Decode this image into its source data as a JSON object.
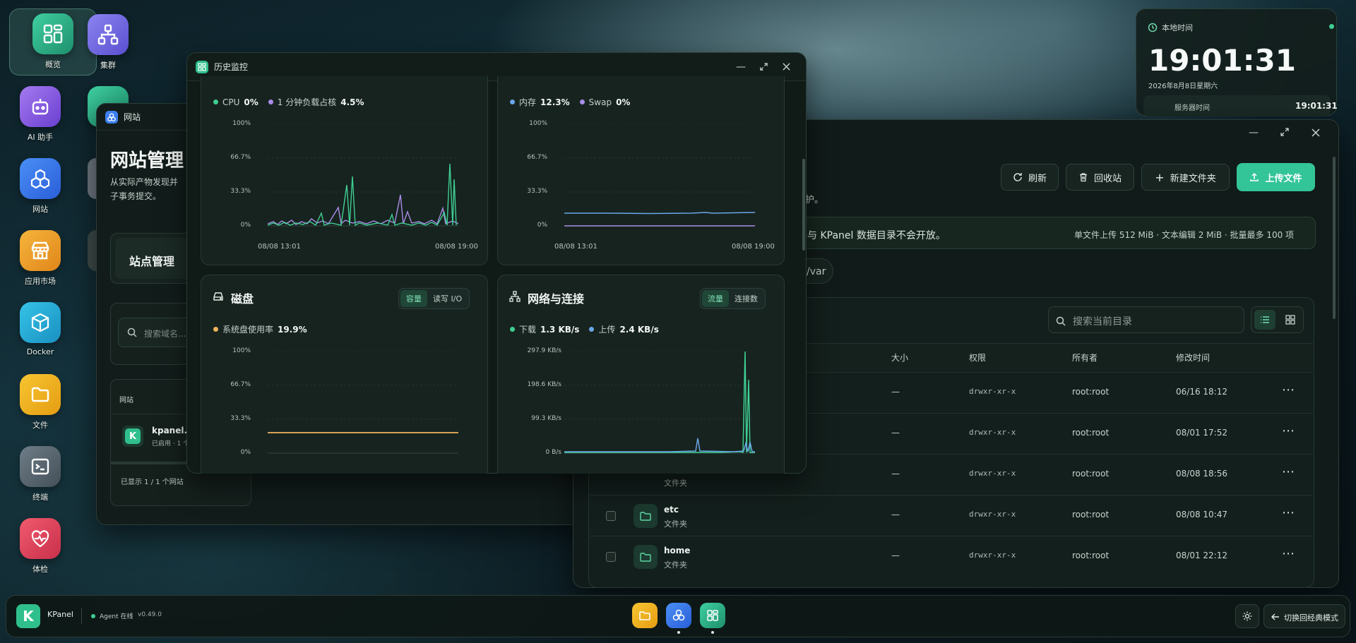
{
  "desktop": {
    "icons": [
      {
        "label": "概览"
      },
      {
        "label": "集群"
      },
      {
        "label": "AI 助手"
      },
      {
        "label": "网站"
      },
      {
        "label": "应用市场"
      },
      {
        "label": "Docker"
      },
      {
        "label": "文件"
      },
      {
        "label": "终端"
      },
      {
        "label": "体检"
      }
    ]
  },
  "clock": {
    "title": "本地时间",
    "time": "19:01:31",
    "date": "2026年8月8日星期六",
    "server_label": "服务器时间",
    "server_time": "19:01:31"
  },
  "website_window": {
    "title": "网站",
    "heading": "网站管理",
    "desc_line1": "从实际产物发现并",
    "desc_line2": "子事务提交。",
    "tab": "站点管理",
    "search_placeholder": "搜索域名...",
    "table_header": "网站",
    "site_name": "kpanel.lo",
    "site_status": "已启用 · 1 个",
    "footer": "已显示 1 / 1 个网站"
  },
  "monitor_window": {
    "title": "历史监控",
    "cpu": {
      "legend1": "CPU",
      "value1": "0%",
      "legend2": "1 分钟负载占核",
      "value2": "4.5%",
      "yticks": [
        "100%",
        "66.7%",
        "33.3%",
        "0%"
      ],
      "xstart": "08/08 13:01",
      "xend": "08/08 19:00"
    },
    "mem": {
      "legend1": "内存",
      "value1": "12.3%",
      "legend2": "Swap",
      "value2": "0%",
      "yticks": [
        "100%",
        "66.7%",
        "33.3%",
        "0%"
      ],
      "xstart": "08/08 13:01",
      "xend": "08/08 19:00"
    },
    "disk": {
      "title": "磁盘",
      "seg_on": "容量",
      "seg_off": "读写 I/O",
      "legend1": "系统盘使用率",
      "value1": "19.9%",
      "yticks": [
        "100%",
        "66.7%",
        "33.3%",
        "0%"
      ],
      "xstart": "08/08 13:01",
      "xend": "08/08 19:00"
    },
    "net": {
      "title": "网络与连接",
      "seg_on": "流量",
      "seg_off": "连接数",
      "legend1": "下载",
      "value1": "1.3 KB/s",
      "legend2": "上传",
      "value2": "2.4 KB/s",
      "yticks": [
        "297.9 KB/s",
        "198.6 KB/s",
        "99.3 KB/s",
        "0 B/s"
      ],
      "xstart": "08/08 13:01",
      "xend": "08/08 19:00"
    },
    "colors": {
      "green": "#3fcf93",
      "purple": "#a98ee8",
      "blue": "#6aa7e8",
      "orange": "#f0b25a"
    }
  },
  "files_window": {
    "toolbar": {
      "refresh": "刷新",
      "recycle": "回收站",
      "new_folder": "新建文件夹",
      "upload": "上传文件"
    },
    "note_fragment": "护。",
    "notice": "与 KPanel 数据目录不会开放。",
    "limits": "单文件上传 512 MiB · 文本编辑 2 MiB · 批量最多 100 项",
    "path_chip": "/var",
    "search_placeholder": "搜索当前目录",
    "columns": {
      "size": "大小",
      "perm": "权限",
      "owner": "所有者",
      "mtime": "修改时间"
    },
    "rows": [
      {
        "name": "",
        "type": "",
        "size": "—",
        "perm": "drwxr-xr-x",
        "owner": "root:root",
        "mtime": "06/16 18:12"
      },
      {
        "name": "",
        "type": "",
        "size": "—",
        "perm": "drwxr-xr-x",
        "owner": "root:root",
        "mtime": "08/01 17:52"
      },
      {
        "name": "",
        "type": "文件夹",
        "size": "—",
        "perm": "drwxr-xr-x",
        "owner": "root:root",
        "mtime": "08/08 18:56"
      },
      {
        "name": "etc",
        "type": "文件夹",
        "size": "—",
        "perm": "drwxr-xr-x",
        "owner": "root:root",
        "mtime": "08/08 10:47"
      },
      {
        "name": "home",
        "type": "文件夹",
        "size": "—",
        "perm": "drwxr-xr-x",
        "owner": "root:root",
        "mtime": "08/01 22:12"
      }
    ]
  },
  "taskbar": {
    "brand": "KPanel",
    "agent": "Agent 在线",
    "version": "v0.49.0",
    "classic": "切换回经典模式"
  }
}
